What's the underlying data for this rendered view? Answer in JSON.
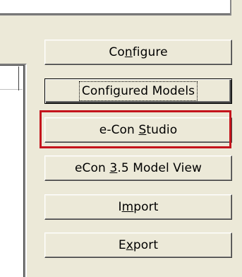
{
  "buttons": [
    {
      "id": "configure",
      "pre": "Co",
      "mnemonic": "n",
      "post": "figure"
    },
    {
      "id": "configured-models",
      "pre": "Confi",
      "mnemonic": "g",
      "post": "ured Models"
    },
    {
      "id": "econ-studio",
      "pre": "e-Con ",
      "mnemonic": "S",
      "post": "tudio"
    },
    {
      "id": "econ-model-view",
      "pre": "eCon ",
      "mnemonic": "3",
      "post": ".5 Model View"
    },
    {
      "id": "import",
      "pre": "I",
      "mnemonic": "m",
      "post": "port"
    },
    {
      "id": "export",
      "pre": "E",
      "mnemonic": "x",
      "post": "port"
    }
  ],
  "colors": {
    "highlight": "#c4141c",
    "background": "#ece9d8"
  }
}
